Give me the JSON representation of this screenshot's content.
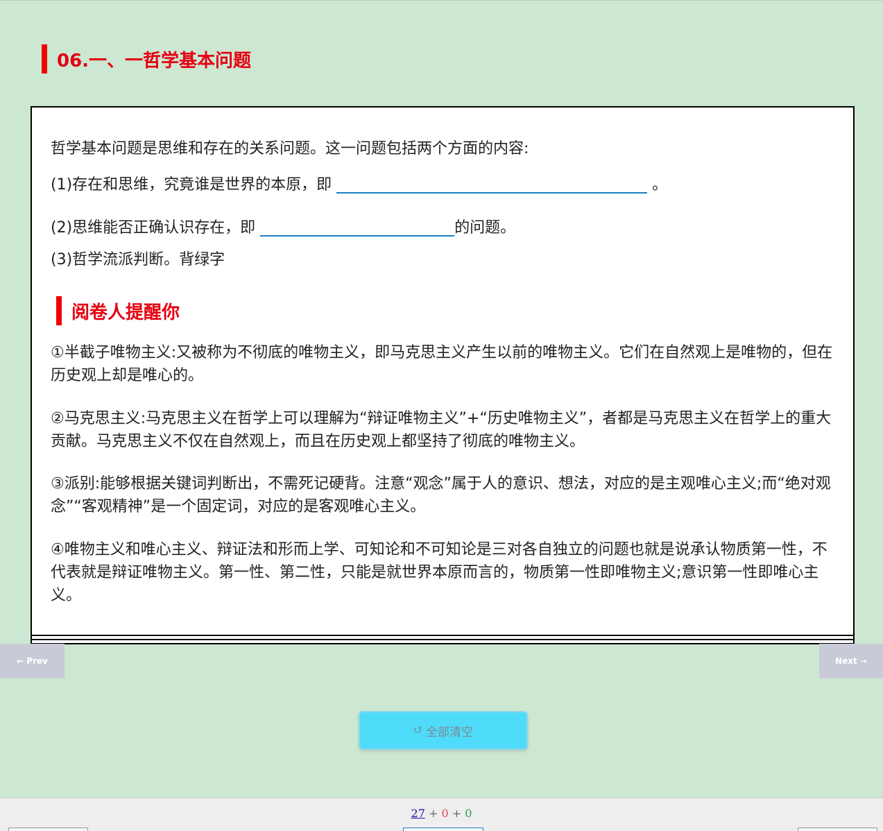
{
  "section": {
    "title": "06.一、一哲学基本问题"
  },
  "card": {
    "intro": "哲学基本问题是思维和存在的关系问题。这一问题包括两个方面的内容:",
    "q1_prefix": "(1)存在和思维，究竟谁是世界的本原，即",
    "q1_suffix": "。",
    "q2_prefix": "(2)思维能否正确认识存在，即",
    "q2_suffix": "的问题。",
    "q3": "(3)哲学流派判断。背绿字",
    "reminder_title": "阅卷人提醒你",
    "paragraphs": [
      "①半截子唯物主义:又被称为不彻底的唯物主义，即马克思主义产生以前的唯物主义。它们在自然观上是唯物的，但在历史观上却是唯心的。",
      "②马克思主义:马克思主义在哲学上可以理解为“辩证唯物主义”+“历史唯物主义”，者都是马克思主义在哲学上的重大贡献。马克思主义不仅在自然观上，而且在历史观上都坚持了彻底的唯物主义。",
      "③派别:能够根据关键词判断出，不需死记硬背。注意“观念”属于人的意识、想法，对应的是主观唯心主义;而“绝对观念”“客观精神”是一个固定词，对应的是客观唯心主义。",
      "④唯物主义和唯心主义、辩证法和形而上学、可知论和不可知论是三对各自独立的问题也就是说承认物质第一性，不代表就是辩证唯物主义。第一性、第二性，只能是就世界本原而言的，物质第一性即唯物主义;意识第一性即唯心主义。"
    ]
  },
  "nav": {
    "prev_label": "← Prev",
    "next_label": "Next →"
  },
  "actions": {
    "clear_icon": "↺",
    "clear_label": "全部清空"
  },
  "footer": {
    "count_main": "27",
    "plus": "+",
    "count_red": "0",
    "count_green": "0"
  },
  "colors": {
    "background": "#cde8d2",
    "accent_red": "#e60012",
    "blank_line": "#1a7fc4",
    "clear_button": "#4fdcfb"
  }
}
